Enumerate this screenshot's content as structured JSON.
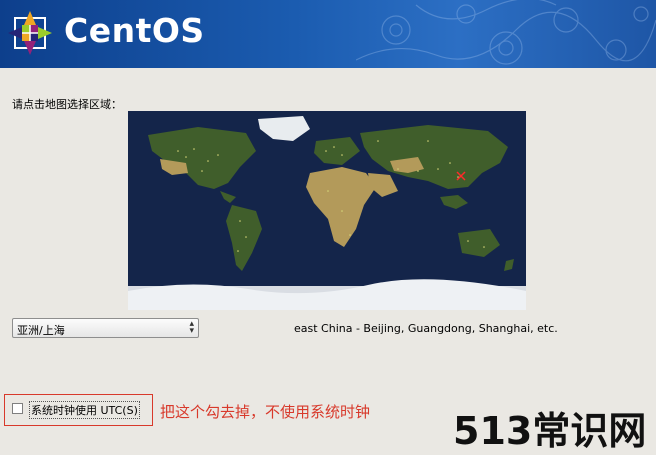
{
  "header": {
    "brand": "CentOS"
  },
  "map_section": {
    "prompt": "请点击地图选择区域："
  },
  "timezone": {
    "selected": "亚洲/上海",
    "description": "east China - Beijing, Guangdong, Shanghai, etc."
  },
  "utc": {
    "label": "系统时钟使用 UTC(S)",
    "checked": false
  },
  "annotation": {
    "note": "把这个勾去掉，不使用系统时钟"
  },
  "watermark": {
    "text": "513常识网"
  },
  "colors": {
    "banner": "#1b5cb0",
    "annotation": "#d8392b",
    "ocean": "#14254a",
    "land": "#3f5f2a"
  }
}
